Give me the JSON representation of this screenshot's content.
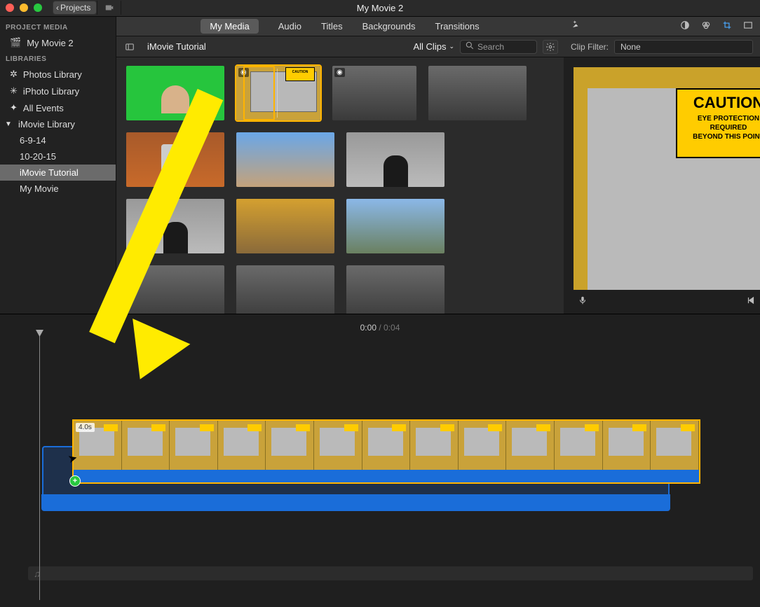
{
  "titlebar": {
    "title": "My Movie 2",
    "projects_btn": "Projects"
  },
  "sidebar": {
    "header_project": "PROJECT MEDIA",
    "header_libraries": "LIBRARIES",
    "project_item": "My Movie 2",
    "lib_items": [
      "Photos Library",
      "iPhoto Library",
      "All Events"
    ],
    "imovie_library": "iMovie Library",
    "events": [
      "6-9-14",
      "10-20-15",
      "iMovie Tutorial",
      "My Movie"
    ]
  },
  "tabs": {
    "my_media": "My Media",
    "audio": "Audio",
    "titles": "Titles",
    "backgrounds": "Backgrounds",
    "transitions": "Transitions"
  },
  "browser": {
    "crumb": "iMovie Tutorial",
    "allclips": "All Clips",
    "search_placeholder": "Search"
  },
  "preview": {
    "clip_filter": "Clip Filter:",
    "filter_value": "None",
    "caution_title": "CAUTION",
    "caution_line1": "EYE PROTECTION",
    "caution_line2": "REQUIRED",
    "caution_line3": "BEYOND THIS POINT"
  },
  "timeline": {
    "time_current": "0:00",
    "time_total": "0:04",
    "drag_duration": "4.0s"
  }
}
